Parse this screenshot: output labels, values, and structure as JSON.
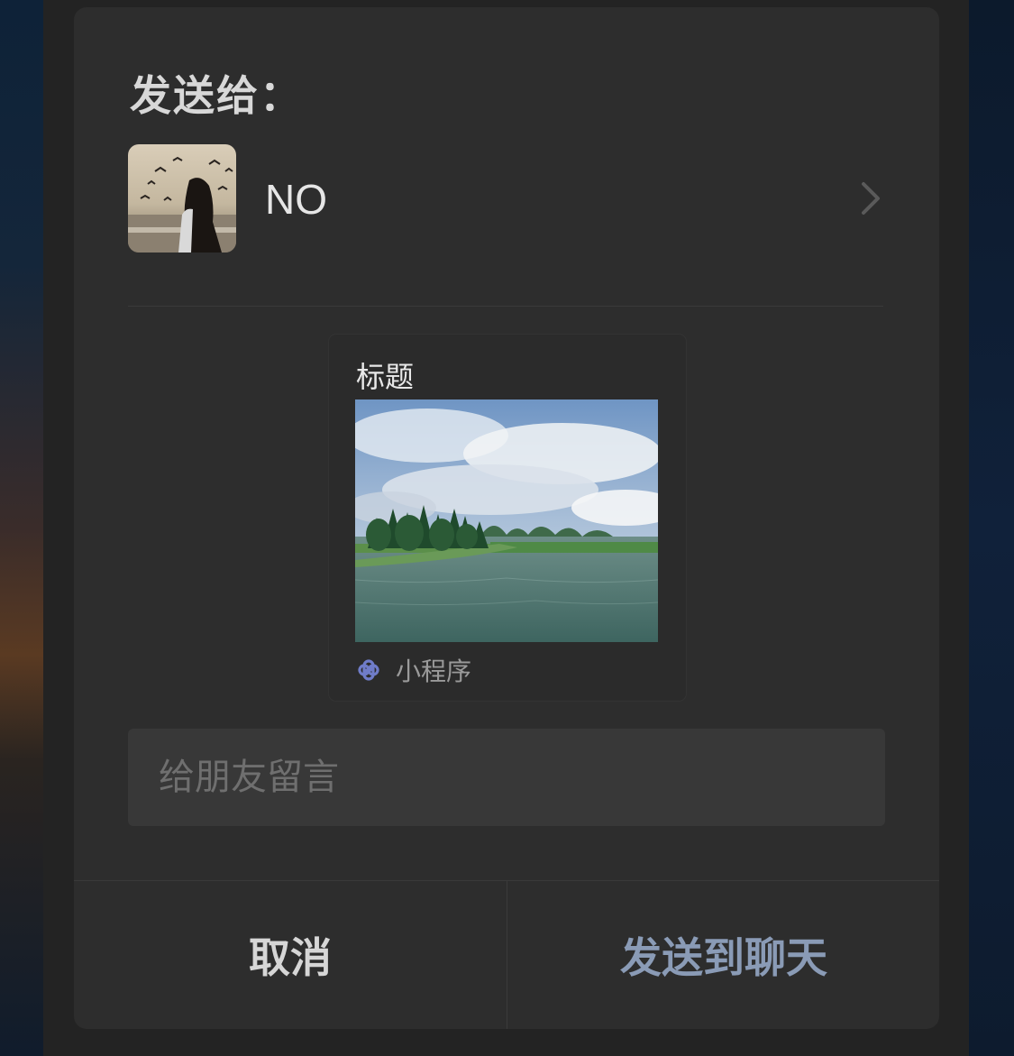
{
  "dialog": {
    "title": "发送给：",
    "recipient": {
      "name": "NO"
    },
    "card": {
      "title": "标题",
      "footer_label": "小程序"
    },
    "message": {
      "placeholder": "给朋友留言",
      "value": ""
    },
    "buttons": {
      "cancel": "取消",
      "send": "发送到聊天"
    }
  },
  "colors": {
    "dialog_bg": "#2d2d2d",
    "send_text": "#8a9bb6",
    "mini_program_icon": "#6f7cc9"
  }
}
